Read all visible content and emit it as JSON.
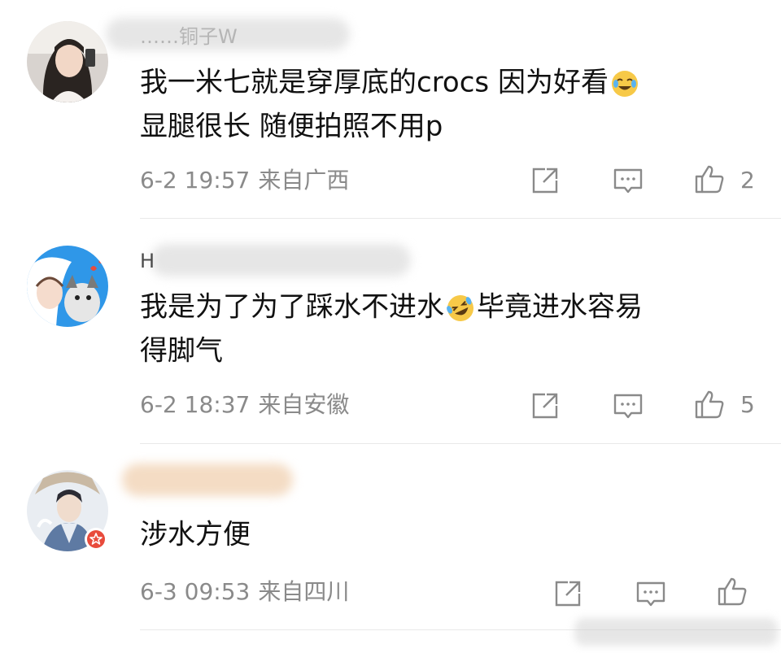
{
  "comments": [
    {
      "username": "……铜子W",
      "text": "我一米七就是穿厚底的crocs 因为好看",
      "text2": "显腿很长 随便拍照不用p",
      "emoji": "crying-laughing-emoji",
      "time": "6-2 19:57",
      "location": "来自广西",
      "likes": "2"
    },
    {
      "username": "H",
      "text": "我是为了为了踩水不进水",
      "emoji": "rofl-emoji",
      "text_after": "毕竟进水容易",
      "text2": "得脚气",
      "time": "6-2 18:37",
      "location": "来自安徽",
      "likes": "5"
    },
    {
      "username": "",
      "text": "涉水方便",
      "time": "6-3 09:53",
      "location": "来自四川",
      "likes": ""
    }
  ],
  "colors": {
    "meta": "#8a8a8a",
    "text": "#111111",
    "divider": "#e9e9e9",
    "badge": "#e84b3c"
  }
}
